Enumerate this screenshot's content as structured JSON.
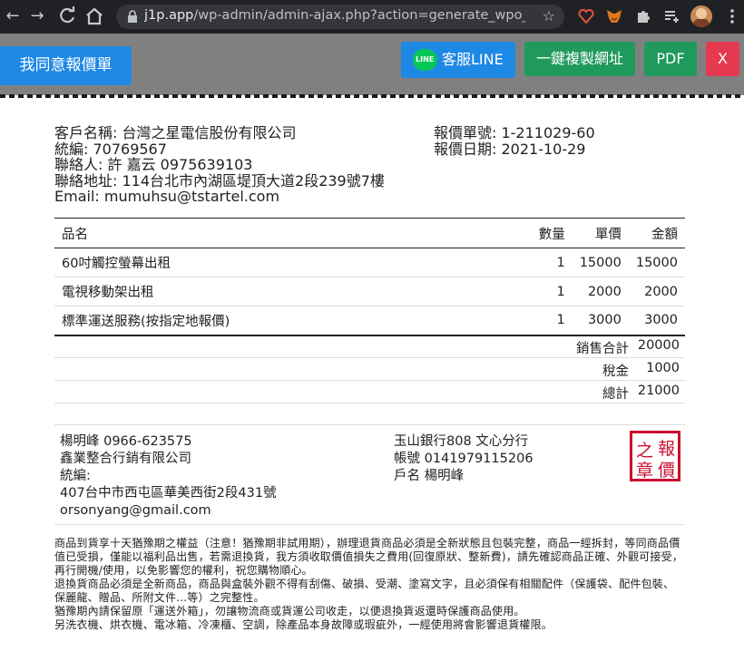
{
  "browser": {
    "url_host": "j1p.app",
    "url_path": "/wp-admin/admin-ajax.php?action=generate_wpo_wc...",
    "icons": [
      "back-icon",
      "forward-icon",
      "reload-icon",
      "home-icon",
      "lock-icon",
      "star-icon",
      "extension-heart-icon",
      "metamask-icon",
      "puzzle-icon",
      "playlist-icon",
      "profile-avatar",
      "menu-kebab-icon"
    ]
  },
  "toolbar": {
    "agree_label": "我同意報價單",
    "line_label": "客服LINE",
    "line_icon_text": "LINE",
    "copy_label": "一鍵複製網址",
    "pdf_label": "PDF",
    "close_label": "X",
    "colors": {
      "blue": "#1e88e5",
      "green": "#1f9a5c",
      "red": "#e53950",
      "bar": "#808080"
    }
  },
  "customer": {
    "name": "客戶名稱: 台灣之星電信股份有限公司",
    "tax_id": "統編: 70769567",
    "contact": "聯絡人: 許 嘉云 0975639103",
    "address": "聯絡地址: 114台北市內湖區堤頂大道2段239號7樓",
    "email": "Email: mumuhsu@tstartel.com"
  },
  "quote": {
    "number": "報價單號: 1-211029-60",
    "date": "報價日期: 2021-10-29"
  },
  "table": {
    "headers": {
      "name": "品名",
      "qty": "數量",
      "price": "單價",
      "amount": "金額"
    },
    "rows": [
      {
        "name": "60吋觸控螢幕出租",
        "qty": "1",
        "price": "15000",
        "amount": "15000"
      },
      {
        "name": "電視移動架出租",
        "qty": "1",
        "price": "2000",
        "amount": "2000"
      },
      {
        "name": "標準運送服務(按指定地報價)",
        "qty": "1",
        "price": "3000",
        "amount": "3000"
      }
    ]
  },
  "totals": {
    "subtotal_label": "銷售合計",
    "subtotal": "20000",
    "tax_label": "稅金",
    "tax": "1000",
    "total_label": "總計",
    "total": "21000"
  },
  "seller": {
    "contact": "楊明峰 0966-623575",
    "company": "鑫業整合行銷有限公司",
    "tax_id": "統編:",
    "address": "407台中市西屯區華美西街2段431號",
    "email": "orsonyang@gmail.com"
  },
  "bank": {
    "bank": "玉山銀行808 文心分行",
    "account": "帳號 0141979115206",
    "holder": "戶名 楊明峰"
  },
  "seal": {
    "c1": "報",
    "c2": "之",
    "c3": "價",
    "c4": "章",
    "color": "#c8102e"
  },
  "terms": {
    "l1": "商品到貨享十天猶豫期之權益（注意！猶豫期非試用期），辦理退貨商品必須是全新狀態且包裝完整，商品一經拆封，等同商品價值已受損，僅能以福利品出售，若需退換貨，我方須收取價值損失之費用(回復原狀、整新費)，請先確認商品正確、外觀可接受，再行開機/使用，以免影響您的權利，祝您購物順心。",
    "l2": "退換貨商品必須是全新商品，商品與盒裝外觀不得有刮傷、破損、受潮、塗寫文字，且必須保有相關配件（保護袋、配件包裝、保麗龍、贈品、所附文件...等）之完整性。",
    "l3": "猶豫期內請保留原「運送外箱」，勿讓物流商或貨運公司收走，以便退換貨返還時保護商品使用。",
    "l4": "另洗衣機、烘衣機、電冰箱、冷凍櫃、空調，除產品本身故障或瑕疵外，一經使用將會影響退貨權限。"
  }
}
